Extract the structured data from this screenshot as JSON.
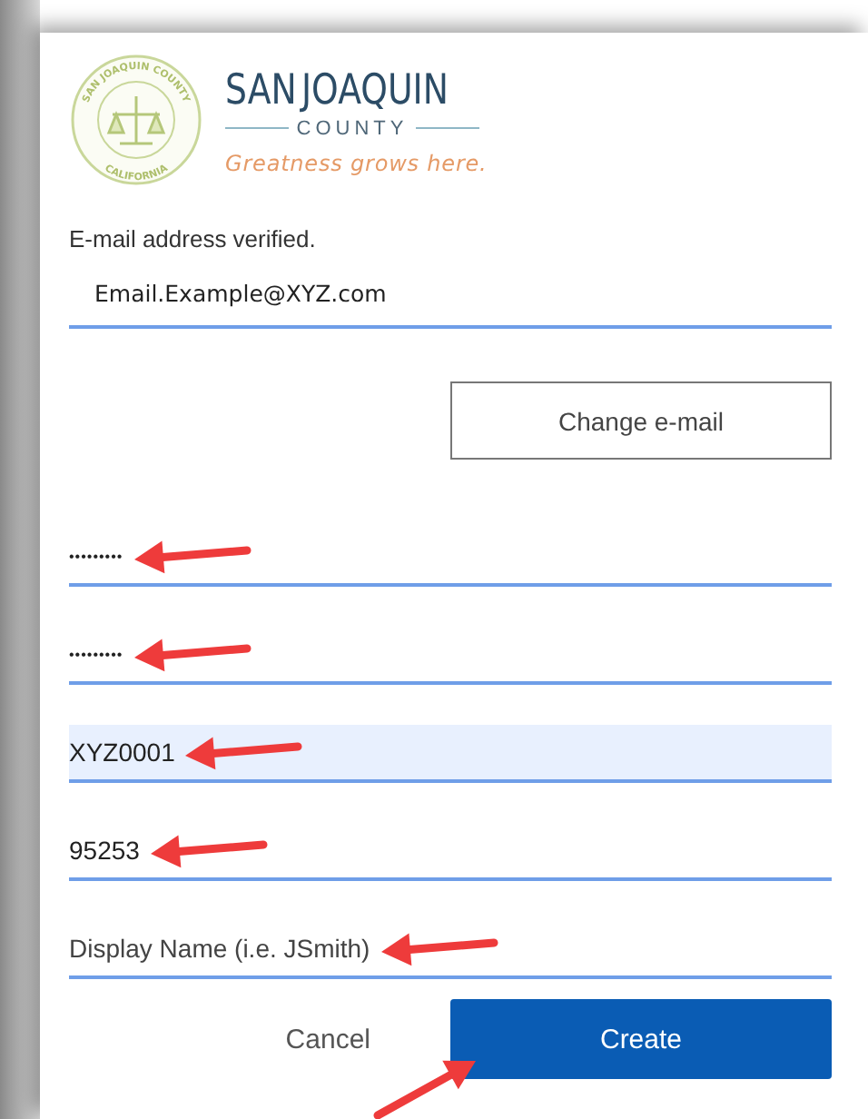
{
  "logo": {
    "seal_top": "SAN JOAQUIN COUNTY",
    "seal_bottom": "CALIFORNIA",
    "name_first": "SAN",
    "name_second": "JOAQUIN",
    "subtitle": "COUNTY",
    "tagline": "Greatness grows here."
  },
  "status": "E-mail address verified.",
  "email": {
    "value": "Email.Example@XYZ.com"
  },
  "change_button": "Change e-mail",
  "fields": [
    {
      "kind": "password",
      "value": "•••••••••",
      "autofilled": false,
      "arrow": true
    },
    {
      "kind": "password",
      "value": "•••••••••",
      "autofilled": false,
      "arrow": true
    },
    {
      "kind": "text",
      "value": "XYZ0001",
      "autofilled": true,
      "arrow": true
    },
    {
      "kind": "text",
      "value": "95253",
      "autofilled": false,
      "arrow": true
    },
    {
      "kind": "text",
      "placeholder": "Display Name (i.e. JSmith)",
      "autofilled": false,
      "arrow": true
    }
  ],
  "actions": {
    "cancel": "Cancel",
    "create": "Create",
    "create_arrow": true
  }
}
